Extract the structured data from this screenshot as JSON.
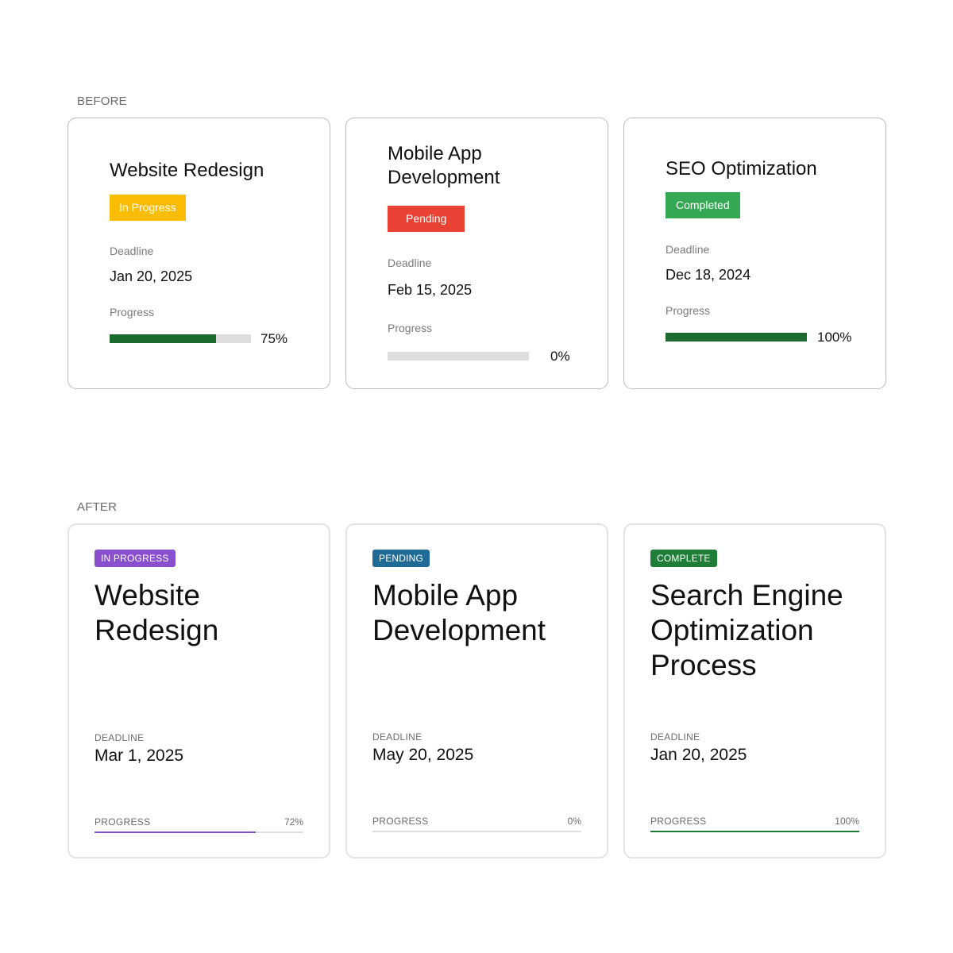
{
  "sections": {
    "before_label": "BEFORE",
    "after_label": "AFTER"
  },
  "before_cards": [
    {
      "title": "Website Redesign",
      "status": "In Progress",
      "status_color": "#fbbc05",
      "deadline_label": "Deadline",
      "deadline": "Jan 20, 2025",
      "progress_label": "Progress",
      "progress_text": "75%",
      "progress": 0.75
    },
    {
      "title": "Mobile App Development",
      "status": "Pending",
      "status_color": "#ea4335",
      "deadline_label": "Deadline",
      "deadline": "Feb 15, 2025",
      "progress_label": "Progress",
      "progress_text": "0%",
      "progress": 0
    },
    {
      "title": "SEO Optimization",
      "status": "Completed",
      "status_color": "#34a853",
      "deadline_label": "Deadline",
      "deadline": "Dec 18, 2024",
      "progress_label": "Progress",
      "progress_text": "100%",
      "progress": 1
    }
  ],
  "after_cards": [
    {
      "status": "IN PROGRESS",
      "status_color": "#8a4fcf",
      "title": "Website Redesign",
      "deadline_label": "DEADLINE",
      "deadline": "Mar 1, 2025",
      "progress_label": "PROGRESS",
      "progress_text": "72%",
      "progress": 0.77,
      "bar_color": "#8a4fcf"
    },
    {
      "status": "PENDING",
      "status_color": "#1f6b96",
      "title": "Mobile App Development",
      "deadline_label": "DEADLINE",
      "deadline": "May 20, 2025",
      "progress_label": "PROGRESS",
      "progress_text": "0%",
      "progress": 0,
      "bar_color": "#1f6b96"
    },
    {
      "status": "COMPLETE",
      "status_color": "#1e7d37",
      "title": "Search Engine Optimization Process",
      "deadline_label": "DEADLINE",
      "deadline": "Jan 20, 2025",
      "progress_label": "PROGRESS",
      "progress_text": "100%",
      "progress": 1,
      "bar_color": "#1e7d37"
    }
  ]
}
